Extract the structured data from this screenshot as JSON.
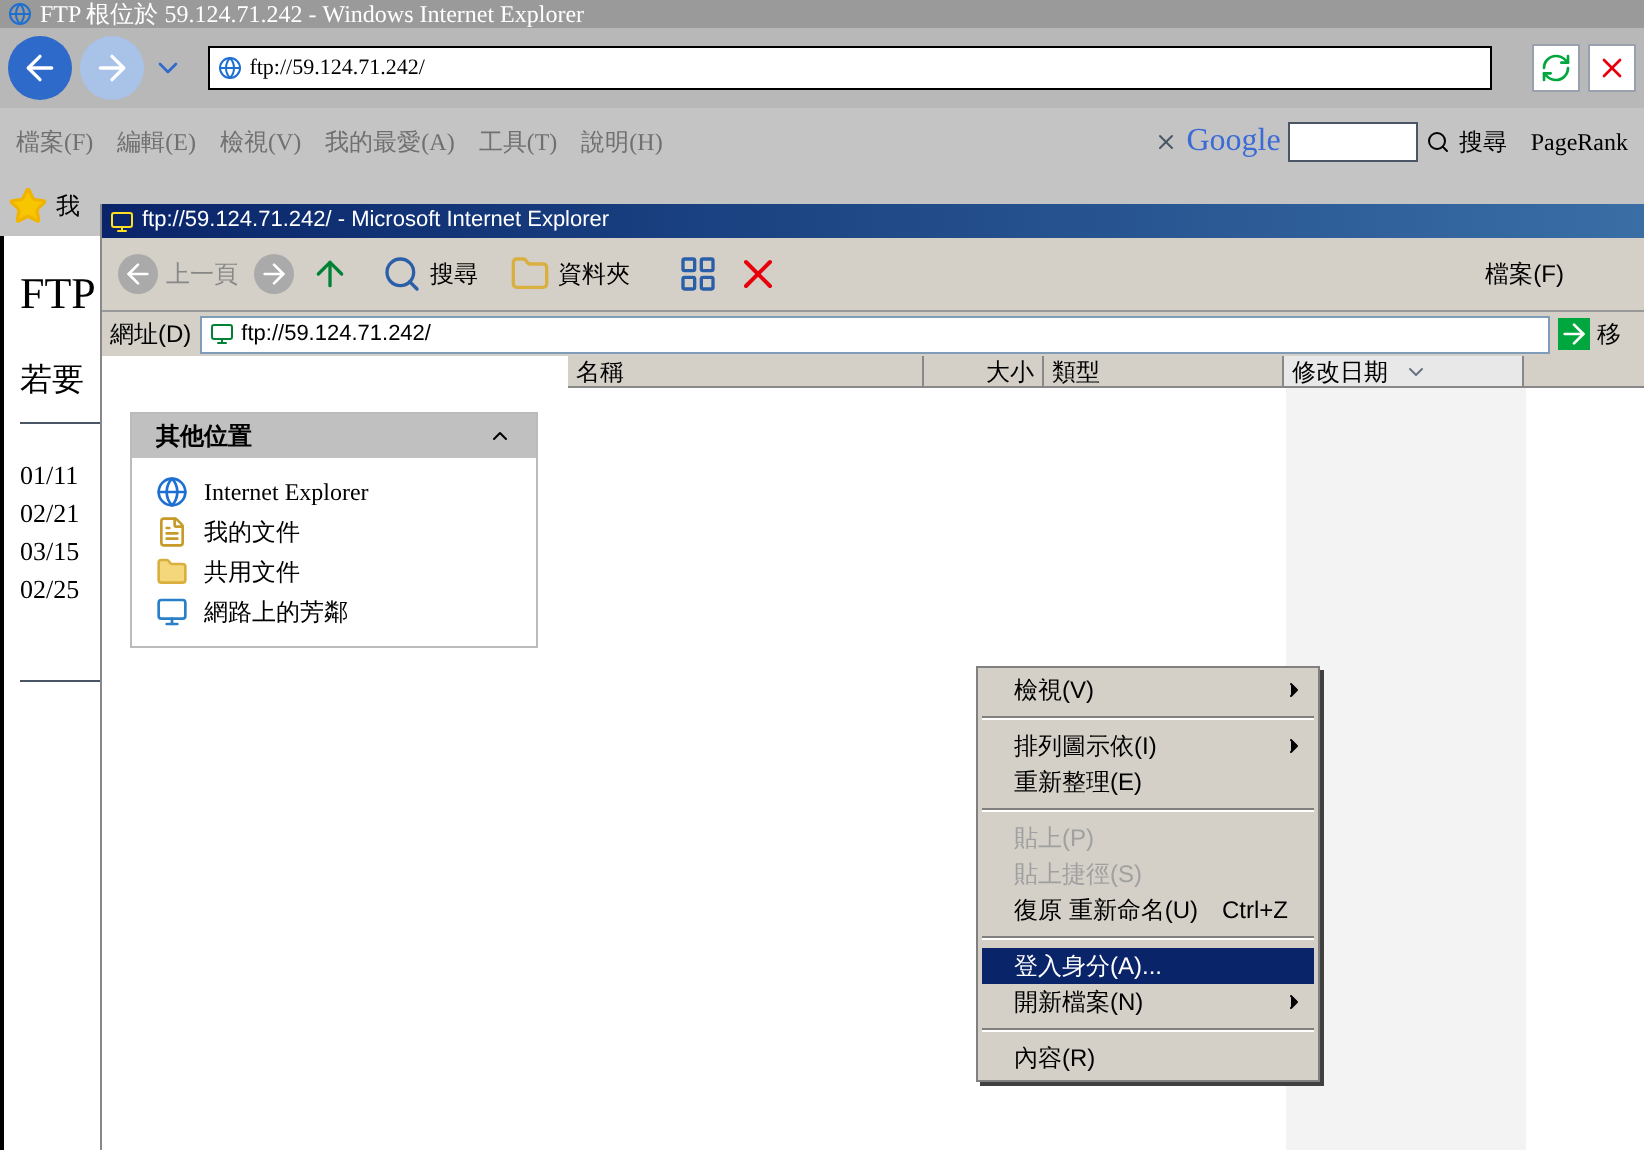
{
  "outer_window": {
    "title": "FTP 根位於 59.124.71.242 - Windows Internet Explorer",
    "address": "ftp://59.124.71.242/",
    "menu": [
      "檔案(F)",
      "編輯(E)",
      "檢視(V)",
      "我的最愛(A)",
      "工具(T)",
      "說明(H)"
    ],
    "google": {
      "logo": "Google",
      "search_label": "搜尋",
      "pagerank": "PageRank"
    },
    "favorites_label": "我",
    "content": {
      "heading": "FTP",
      "line": "若要",
      "dates": [
        "01/11",
        "02/21",
        "03/15",
        "02/25"
      ]
    }
  },
  "inner_window": {
    "title": "ftp://59.124.71.242/ - Microsoft Internet Explorer",
    "toolbar": {
      "back": "上一頁",
      "search": "搜尋",
      "folders": "資料夾",
      "file_menu": "檔案(F)"
    },
    "address_label": "網址(D)",
    "address": "ftp://59.124.71.242/",
    "go": "移",
    "columns": [
      {
        "label": "名稱",
        "sorted": false
      },
      {
        "label": "大小",
        "sorted": false
      },
      {
        "label": "類型",
        "sorted": false
      },
      {
        "label": "修改日期",
        "sorted": true
      }
    ],
    "panel": {
      "title": "其他位置",
      "items": [
        {
          "label": "Internet Explorer",
          "kind": "browser"
        },
        {
          "label": "我的文件",
          "kind": "documents"
        },
        {
          "label": "共用文件",
          "kind": "folder"
        },
        {
          "label": "網路上的芳鄰",
          "kind": "network"
        }
      ]
    },
    "context_menu": [
      {
        "kind": "item",
        "label": "檢視(V)",
        "submenu": true,
        "disabled": false,
        "selected": false
      },
      {
        "kind": "separator"
      },
      {
        "kind": "item",
        "label": "排列圖示依(I)",
        "submenu": true,
        "disabled": false,
        "selected": false
      },
      {
        "kind": "item",
        "label": "重新整理(E)",
        "submenu": false,
        "disabled": false,
        "selected": false
      },
      {
        "kind": "separator"
      },
      {
        "kind": "item",
        "label": "貼上(P)",
        "submenu": false,
        "disabled": true,
        "selected": false
      },
      {
        "kind": "item",
        "label": "貼上捷徑(S)",
        "submenu": false,
        "disabled": true,
        "selected": false
      },
      {
        "kind": "item",
        "label": "復原 重新命名(U)",
        "shortcut": "Ctrl+Z",
        "submenu": false,
        "disabled": false,
        "selected": false
      },
      {
        "kind": "separator"
      },
      {
        "kind": "item",
        "label": "登入身分(A)...",
        "submenu": false,
        "disabled": false,
        "selected": true
      },
      {
        "kind": "item",
        "label": "開新檔案(N)",
        "submenu": true,
        "disabled": false,
        "selected": false
      },
      {
        "kind": "separator"
      },
      {
        "kind": "item",
        "label": "內容(R)",
        "submenu": false,
        "disabled": false,
        "selected": false
      }
    ]
  }
}
